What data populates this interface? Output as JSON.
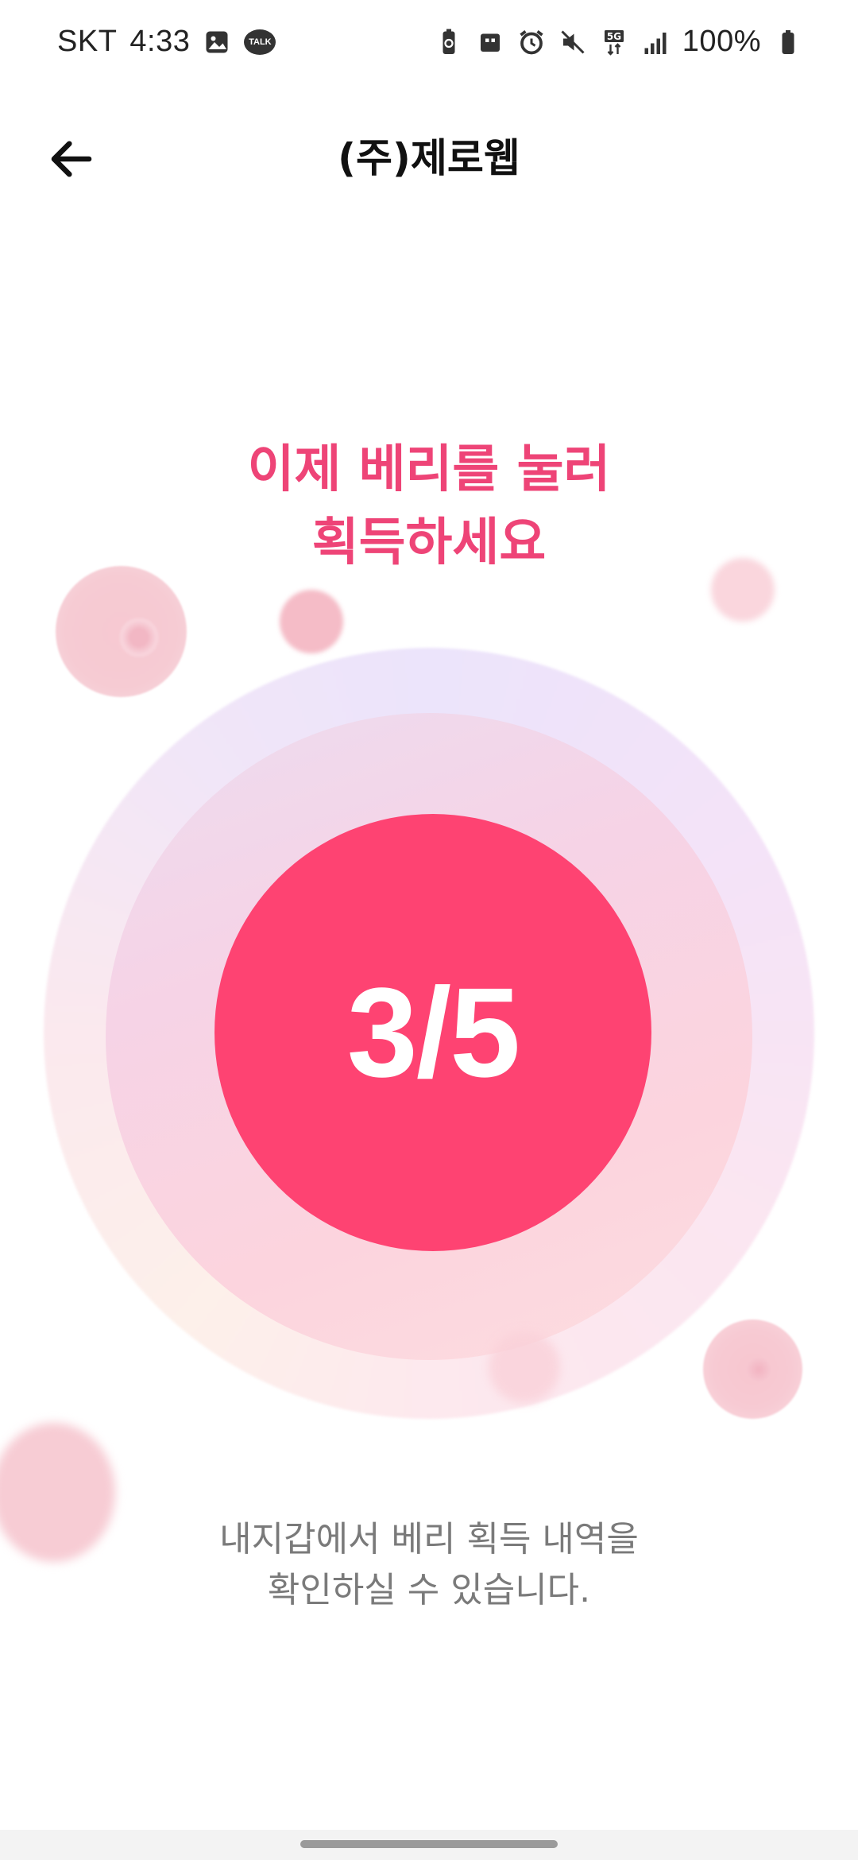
{
  "status_bar": {
    "carrier": "SKT",
    "time": "4:33",
    "talk_badge": "TALK",
    "network": "5G",
    "battery": "100%"
  },
  "header": {
    "title": "(주)제로웹"
  },
  "main": {
    "message_line1": "이제 베리를 눌러",
    "message_line2": "획득하세요",
    "progress_text": "3/5",
    "progress": {
      "current": 3,
      "total": 5
    },
    "accent_color": "#fe4372"
  },
  "info": {
    "line1": "내지갑에서 베리 획득 내역을",
    "line2": "확인하실 수 있습니다."
  },
  "icons": {
    "back": "arrow-left-icon",
    "gallery": "image-icon",
    "alarm": "alarm-icon",
    "mute": "mute-icon",
    "signal": "signal-icon",
    "battery": "battery-icon"
  }
}
